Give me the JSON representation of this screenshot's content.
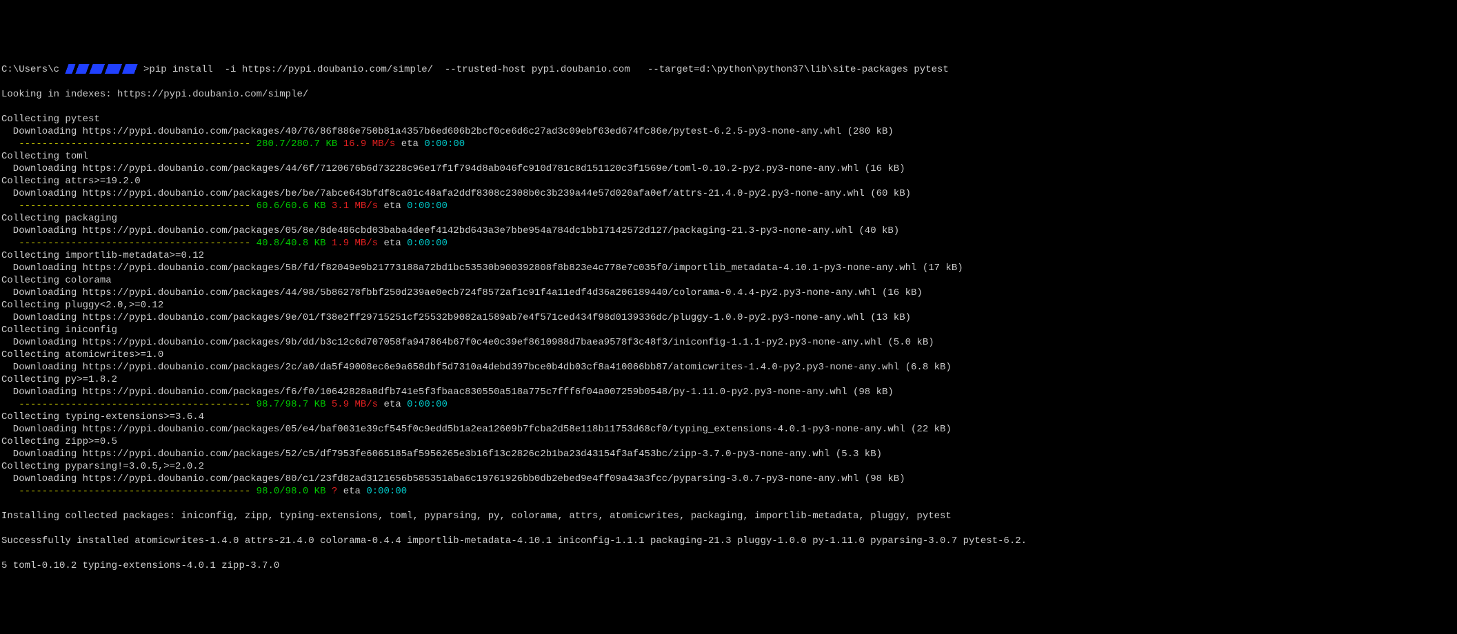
{
  "prompt": {
    "prefix": "C:\\Users\\c",
    "suffix": ">",
    "command": "pip install  -i https://pypi.doubanio.com/simple/  --trusted-host pypi.doubanio.com   --target=d:\\python\\python37\\lib\\site-packages pytest"
  },
  "indexes_line": "Looking in indexes: https://pypi.doubanio.com/simple/",
  "dash_rule": "   ---------------------------------------- ",
  "eta_label": " eta ",
  "packages": [
    {
      "collect": "Collecting pytest",
      "download": "  Downloading https://pypi.doubanio.com/packages/40/76/86f886e750b81a4357b6ed606b2bcf0ce6d6c27ad3c09ebf63ed674fc86e/pytest-6.2.5-py3-none-any.whl (280 kB)",
      "progress": {
        "size": "280.7/280.7 KB",
        "speed": "16.9 MB/s",
        "eta": "0:00:00"
      }
    },
    {
      "collect": "Collecting toml",
      "download": "  Downloading https://pypi.doubanio.com/packages/44/6f/7120676b6d73228c96e17f1f794d8ab046fc910d781c8d151120c3f1569e/toml-0.10.2-py2.py3-none-any.whl (16 kB)"
    },
    {
      "collect": "Collecting attrs>=19.2.0",
      "download": "  Downloading https://pypi.doubanio.com/packages/be/be/7abce643bfdf8ca01c48afa2ddf8308c2308b0c3b239a44e57d020afa0ef/attrs-21.4.0-py2.py3-none-any.whl (60 kB)",
      "progress": {
        "size": "60.6/60.6 KB",
        "speed": "3.1 MB/s",
        "eta": "0:00:00"
      }
    },
    {
      "collect": "Collecting packaging",
      "download": "  Downloading https://pypi.doubanio.com/packages/05/8e/8de486cbd03baba4deef4142bd643a3e7bbe954a784dc1bb17142572d127/packaging-21.3-py3-none-any.whl (40 kB)",
      "progress": {
        "size": "40.8/40.8 KB",
        "speed": "1.9 MB/s",
        "eta": "0:00:00"
      }
    },
    {
      "collect": "Collecting importlib-metadata>=0.12",
      "download": "  Downloading https://pypi.doubanio.com/packages/58/fd/f82049e9b21773188a72bd1bc53530b900392808f8b823e4c778e7c035f0/importlib_metadata-4.10.1-py3-none-any.whl (17 kB)"
    },
    {
      "collect": "Collecting colorama",
      "download": "  Downloading https://pypi.doubanio.com/packages/44/98/5b86278fbbf250d239ae0ecb724f8572af1c91f4a11edf4d36a206189440/colorama-0.4.4-py2.py3-none-any.whl (16 kB)"
    },
    {
      "collect": "Collecting pluggy<2.0,>=0.12",
      "download": "  Downloading https://pypi.doubanio.com/packages/9e/01/f38e2ff29715251cf25532b9082a1589ab7e4f571ced434f98d0139336dc/pluggy-1.0.0-py2.py3-none-any.whl (13 kB)"
    },
    {
      "collect": "Collecting iniconfig",
      "download": "  Downloading https://pypi.doubanio.com/packages/9b/dd/b3c12c6d707058fa947864b67f0c4e0c39ef8610988d7baea9578f3c48f3/iniconfig-1.1.1-py2.py3-none-any.whl (5.0 kB)"
    },
    {
      "collect": "Collecting atomicwrites>=1.0",
      "download": "  Downloading https://pypi.doubanio.com/packages/2c/a0/da5f49008ec6e9a658dbf5d7310a4debd397bce0b4db03cf8a410066bb87/atomicwrites-1.4.0-py2.py3-none-any.whl (6.8 kB)"
    },
    {
      "collect": "Collecting py>=1.8.2",
      "download": "  Downloading https://pypi.doubanio.com/packages/f6/f0/10642828a8dfb741e5f3fbaac830550a518a775c7fff6f04a007259b0548/py-1.11.0-py2.py3-none-any.whl (98 kB)",
      "progress": {
        "size": "98.7/98.7 KB",
        "speed": "5.9 MB/s",
        "eta": "0:00:00"
      }
    },
    {
      "collect": "Collecting typing-extensions>=3.6.4",
      "download": "  Downloading https://pypi.doubanio.com/packages/05/e4/baf0031e39cf545f0c9edd5b1a2ea12609b7fcba2d58e118b11753d68cf0/typing_extensions-4.0.1-py3-none-any.whl (22 kB)"
    },
    {
      "collect": "Collecting zipp>=0.5",
      "download": "  Downloading https://pypi.doubanio.com/packages/52/c5/df7953fe6065185af5956265e3b16f13c2826c2b1ba23d43154f3af453bc/zipp-3.7.0-py3-none-any.whl (5.3 kB)"
    },
    {
      "collect": "Collecting pyparsing!=3.0.5,>=2.0.2",
      "download": "  Downloading https://pypi.doubanio.com/packages/80/c1/23fd82ad3121656b585351aba6c19761926bb0db2ebed9e4ff09a43a3fcc/pyparsing-3.0.7-py3-none-any.whl (98 kB)",
      "progress": {
        "size": "98.0/98.0 KB",
        "speed": "?",
        "eta": "0:00:00"
      }
    }
  ],
  "installing_line": "Installing collected packages: iniconfig, zipp, typing-extensions, toml, pyparsing, py, colorama, attrs, atomicwrites, packaging, importlib-metadata, pluggy, pytest",
  "success_line1": "Successfully installed atomicwrites-1.4.0 attrs-21.4.0 colorama-0.4.4 importlib-metadata-4.10.1 iniconfig-1.1.1 packaging-21.3 pluggy-1.0.0 py-1.11.0 pyparsing-3.0.7 pytest-6.2.",
  "success_line2": "5 toml-0.10.2 typing-extensions-4.0.1 zipp-3.7.0"
}
